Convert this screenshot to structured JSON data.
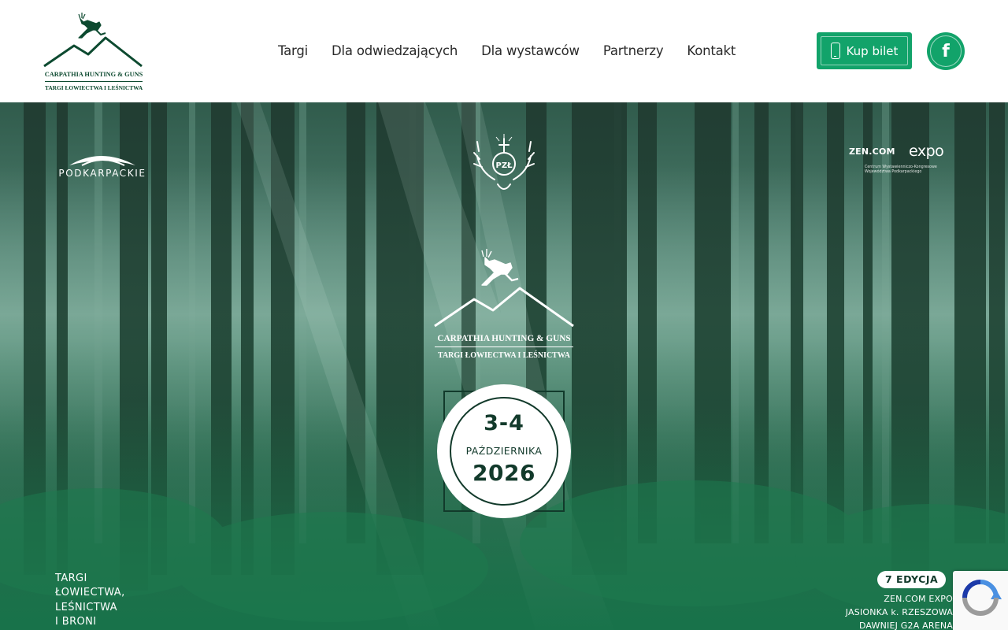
{
  "header": {
    "logo": {
      "line1": "CARPATHIA HUNTING & GUNS",
      "line2": "TARGI ŁOWIECTWA I LEŚNICTWA"
    },
    "nav": [
      {
        "label": "Targi"
      },
      {
        "label": "Dla odwiedzających"
      },
      {
        "label": "Dla wystawców"
      },
      {
        "label": "Partnerzy"
      },
      {
        "label": "Kontakt"
      }
    ],
    "ticket_button": {
      "label": "Kup bilet",
      "icon": "phone-icon"
    },
    "social": {
      "facebook_glyph": "f",
      "icon": "facebook-icon"
    }
  },
  "hero": {
    "partners": {
      "podkarpackie": "PODKARPACKIE",
      "pzl": "PZŁ",
      "zen_brand": "ZEN.COM",
      "zen_expo": "expo",
      "zen_sub_1": "Centrum Wystawienniczo-Kongresowe",
      "zen_sub_2": "Województwa Podkarpackiego"
    },
    "center_logo": {
      "line1": "CARPATHIA HUNTING & GUNS",
      "line2": "TARGI ŁOWIECTWA I LEŚNICTWA"
    },
    "date": {
      "days": "3-4",
      "month": "PAŹDZIERNIKA",
      "year": "2026"
    },
    "tagline": [
      "TARGI",
      "ŁOWIECTWA,",
      "LEŚNICTWA",
      "I BRONI"
    ],
    "edition": "7 EDYCJA",
    "venue": [
      "ZEN.COM EXPO",
      "JASIONKA k. RZESZOWA",
      "DAWNIEJ G2A ARENA"
    ]
  },
  "colors": {
    "brand_green": "#12a36a",
    "dark_green": "#123a2b",
    "logo_green": "#0d4a30"
  }
}
